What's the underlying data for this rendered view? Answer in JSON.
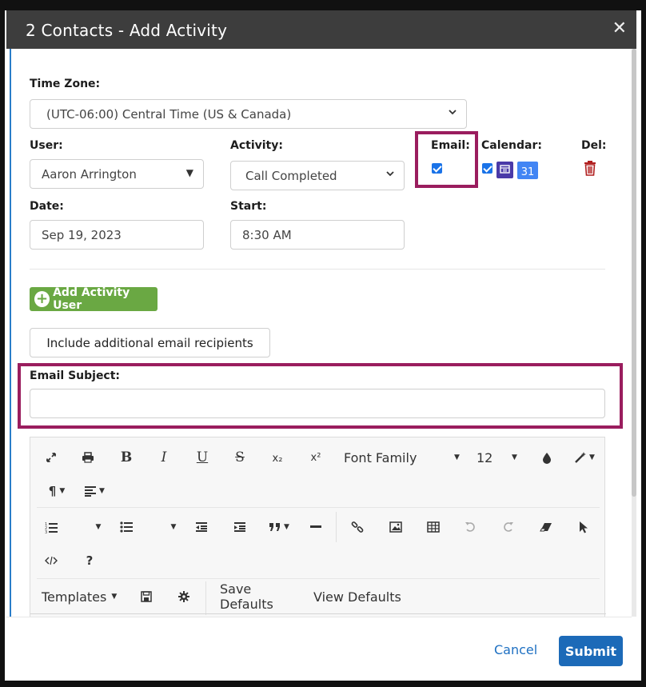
{
  "dialog": {
    "title": "2 Contacts - Add Activity"
  },
  "form": {
    "timezone_label": "Time Zone:",
    "timezone_value": "(UTC-06:00) Central Time (US & Canada)",
    "user_label": "User:",
    "user_value": "Aaron Arrington",
    "activity_label": "Activity:",
    "activity_value": "Call Completed",
    "email_label": "Email:",
    "calendar_label": "Calendar:",
    "del_label": "Del:",
    "date_label": "Date:",
    "date_value": "Sep 19, 2023",
    "start_label": "Start:",
    "start_value": "8:30 AM",
    "email_subject_label": "Email Subject:",
    "email_subject_value": ""
  },
  "buttons": {
    "add_activity_user": "Add Activity User",
    "include_recipients": "Include additional email recipients",
    "cancel": "Cancel",
    "submit": "Submit"
  },
  "editor": {
    "font_family": "Font Family",
    "font_size": "12",
    "bold": "B",
    "italic": "I",
    "underline": "U",
    "strike": "S",
    "subscript": "x₂",
    "superscript": "x²",
    "help": "?",
    "paragraph": "¶",
    "templates": "Templates",
    "save_defaults": "Save Defaults",
    "view_defaults": "View Defaults",
    "calendar_day": "31"
  },
  "colors": {
    "title_bar": "#3d3d3d",
    "highlight": "#9a1d5e",
    "green_button": "#6aa843",
    "primary": "#1c6ab8",
    "delete_icon": "#b01e1e"
  }
}
